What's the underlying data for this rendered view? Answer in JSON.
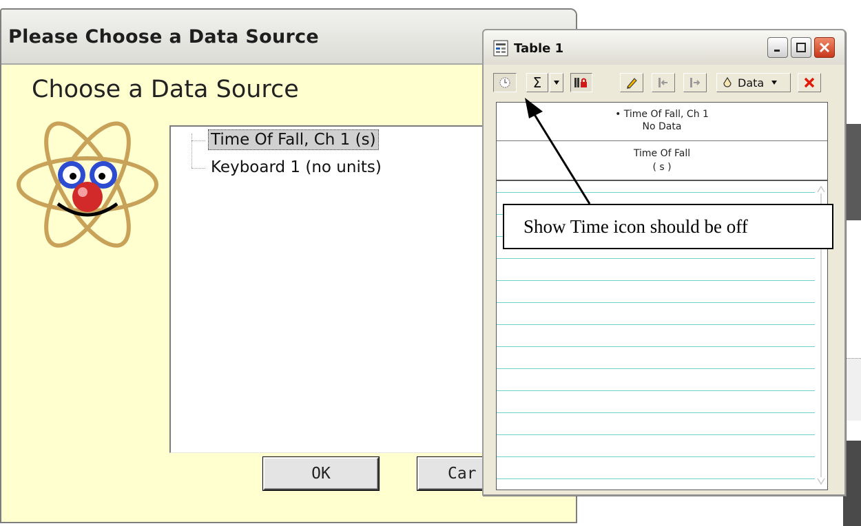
{
  "dialog": {
    "title": "Please Choose a Data Source",
    "heading": "Choose a Data Source",
    "sources": [
      {
        "label": "Time Of Fall, Ch 1 (s)",
        "selected": true
      },
      {
        "label": "Keyboard 1 (no units)",
        "selected": false
      }
    ],
    "ok_label": "OK",
    "cancel_label": "Car"
  },
  "table_window": {
    "title": "Table 1",
    "toolbar": {
      "sigma": "Σ",
      "data_label": "Data"
    },
    "column": {
      "source_line": "Time Of Fall, Ch 1",
      "status": "No Data",
      "name": "Time Of Fall",
      "units": "( s )"
    },
    "row_count": 14
  },
  "annotation": {
    "text": "Show Time icon should be off"
  },
  "colors": {
    "dialog_bg": "#ffffcf",
    "grid_line": "#6cd0d0",
    "close_red": "#c8381c"
  }
}
